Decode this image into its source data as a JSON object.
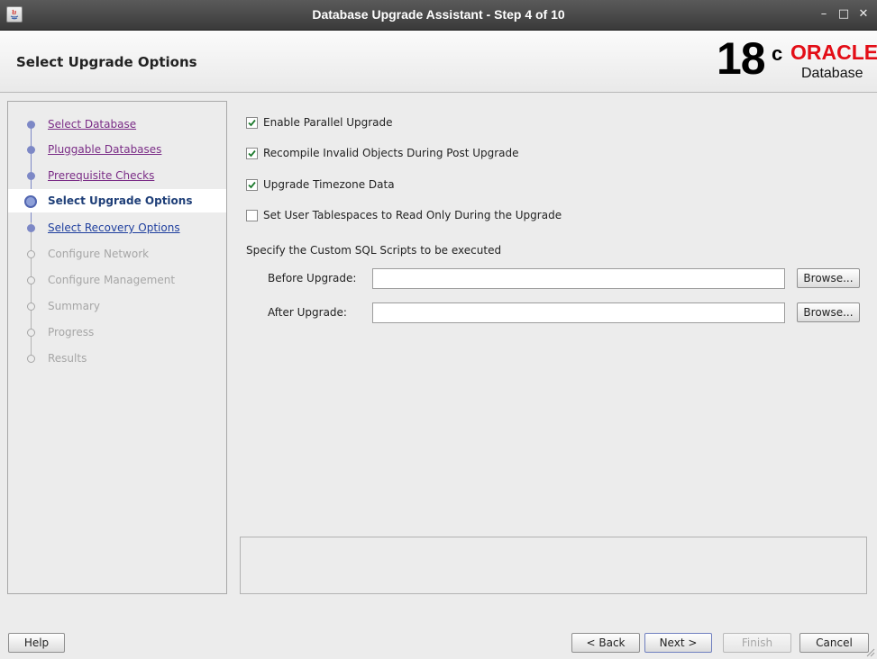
{
  "window": {
    "title": "Database Upgrade Assistant - Step 4 of 10",
    "minimize_glyph": "–",
    "maximize_glyph": "□",
    "close_glyph": "✕"
  },
  "header": {
    "page_title": "Select Upgrade Options",
    "logo": {
      "version": "18",
      "superscript": "c",
      "brand": "ORACLE",
      "product": "Database"
    }
  },
  "sidebar": {
    "steps": [
      {
        "label": "Select Database",
        "state": "done"
      },
      {
        "label": "Pluggable Databases",
        "state": "done"
      },
      {
        "label": "Prerequisite Checks",
        "state": "done"
      },
      {
        "label": "Select Upgrade Options",
        "state": "current"
      },
      {
        "label": "Select Recovery Options",
        "state": "next"
      },
      {
        "label": "Configure Network",
        "state": "todo"
      },
      {
        "label": "Configure Management",
        "state": "todo"
      },
      {
        "label": "Summary",
        "state": "todo"
      },
      {
        "label": "Progress",
        "state": "todo"
      },
      {
        "label": "Results",
        "state": "todo"
      }
    ]
  },
  "options": {
    "parallel_upgrade": {
      "label": "Enable Parallel Upgrade",
      "checked": true
    },
    "recompile_invalid": {
      "label": "Recompile Invalid Objects During Post Upgrade",
      "checked": true
    },
    "upgrade_timezone": {
      "label": "Upgrade Timezone Data",
      "checked": true
    },
    "read_only_tablespaces": {
      "label": "Set User Tablespaces to Read Only During the Upgrade",
      "checked": false
    }
  },
  "custom_scripts": {
    "section_label": "Specify the Custom SQL Scripts to be executed",
    "before": {
      "label": "Before Upgrade:",
      "value": "",
      "browse_label": "Browse..."
    },
    "after": {
      "label": "After Upgrade:",
      "value": "",
      "browse_label": "Browse..."
    }
  },
  "footer": {
    "help_label": "Help",
    "back_label": "< Back",
    "next_label": "Next >",
    "finish_label": "Finish",
    "cancel_label": "Cancel"
  }
}
